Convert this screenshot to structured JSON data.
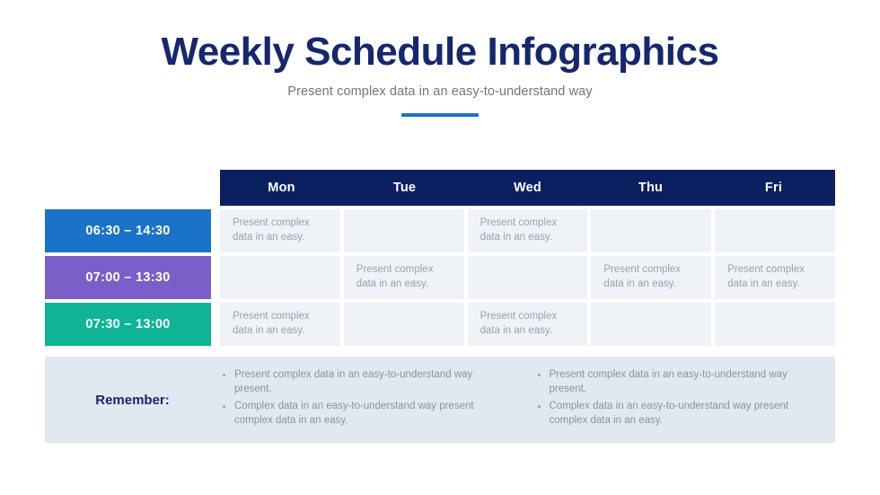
{
  "header": {
    "title": "Weekly Schedule Infographics",
    "subtitle": "Present complex data in an easy-to-understand way"
  },
  "colors": {
    "title_navy": "#16276e",
    "header_navy": "#0a2060",
    "accent_blue": "#1a73c8",
    "row1_blue": "#1a73c8",
    "row2_purple": "#7b5ec7",
    "row3_teal": "#0fb496",
    "cell_bg": "#eff2f7",
    "band_bg": "#e2e8f0",
    "body_gray": "#9aa2ad"
  },
  "schedule": {
    "day_headers": [
      "Mon",
      "Tue",
      "Wed",
      "Thu",
      "Fri"
    ],
    "cell_text": "Present complex data in an easy.",
    "rows": [
      {
        "time_label": "06:30 – 14:30",
        "color": "#1a73c8",
        "cells": [
          {
            "day": "Mon",
            "filled": true,
            "text": "Present complex data in an easy."
          },
          {
            "day": "Tue",
            "filled": false,
            "text": ""
          },
          {
            "day": "Wed",
            "filled": true,
            "text": "Present complex data in an easy."
          },
          {
            "day": "Thu",
            "filled": false,
            "text": ""
          },
          {
            "day": "Fri",
            "filled": false,
            "text": ""
          }
        ]
      },
      {
        "time_label": "07:00 – 13:30",
        "color": "#7b5ec7",
        "cells": [
          {
            "day": "Mon",
            "filled": false,
            "text": ""
          },
          {
            "day": "Tue",
            "filled": true,
            "text": "Present complex data in an easy."
          },
          {
            "day": "Wed",
            "filled": false,
            "text": ""
          },
          {
            "day": "Thu",
            "filled": true,
            "text": "Present complex data in an easy."
          },
          {
            "day": "Fri",
            "filled": true,
            "text": "Present complex data in an easy."
          }
        ]
      },
      {
        "time_label": "07:30 – 13:00",
        "color": "#0fb496",
        "cells": [
          {
            "day": "Mon",
            "filled": true,
            "text": "Present complex data in an easy."
          },
          {
            "day": "Tue",
            "filled": false,
            "text": ""
          },
          {
            "day": "Wed",
            "filled": true,
            "text": "Present complex data in an easy."
          },
          {
            "day": "Thu",
            "filled": false,
            "text": ""
          },
          {
            "day": "Fri",
            "filled": false,
            "text": ""
          }
        ]
      }
    ]
  },
  "remember": {
    "label": "Remember:",
    "columns": [
      {
        "bullets": [
          "Present complex data in an easy-to-understand way present.",
          "Complex data in an easy-to-understand way present complex data in an easy."
        ]
      },
      {
        "bullets": [
          "Present complex data in an easy-to-understand way present.",
          "Complex data in an easy-to-understand way present complex data in an easy."
        ]
      }
    ]
  }
}
